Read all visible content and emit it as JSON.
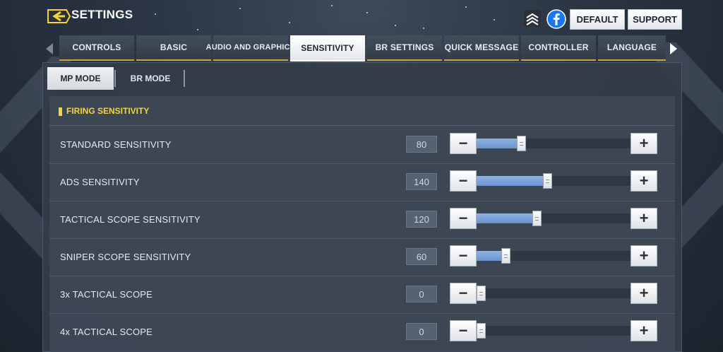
{
  "header": {
    "title": "SETTINGS",
    "default_label": "DEFAULT",
    "support_label": "SUPPORT",
    "back_icon": "back-arrow-icon",
    "cod_icon": "cod-chevron-icon",
    "facebook_icon": "facebook-icon"
  },
  "tabs": [
    {
      "label": "CONTROLS",
      "active": false
    },
    {
      "label": "BASIC",
      "active": false
    },
    {
      "label": "AUDIO AND GRAPHICS",
      "active": false
    },
    {
      "label": "SENSITIVITY",
      "active": true
    },
    {
      "label": "BR SETTINGS",
      "active": false
    },
    {
      "label": "QUICK MESSAGE",
      "active": false
    },
    {
      "label": "CONTROLLER",
      "active": false
    },
    {
      "label": "LANGUAGE",
      "active": false
    }
  ],
  "modes": [
    {
      "label": "MP MODE",
      "active": true
    },
    {
      "label": "BR MODE",
      "active": false
    }
  ],
  "section": {
    "title": "FIRING SENSITIVITY"
  },
  "rows": [
    {
      "label": "STANDARD SENSITIVITY",
      "value": "80",
      "level": 0.29
    },
    {
      "label": "ADS SENSITIVITY",
      "value": "140",
      "level": 0.46
    },
    {
      "label": "TACTICAL SCOPE SENSITIVITY",
      "value": "120",
      "level": 0.39
    },
    {
      "label": "SNIPER SCOPE SENSITIVITY",
      "value": "60",
      "level": 0.19
    },
    {
      "label": "3x TACTICAL SCOPE",
      "value": "0",
      "level": 0.0
    },
    {
      "label": "4x TACTICAL SCOPE",
      "value": "0",
      "level": 0.0
    }
  ],
  "colors": {
    "accent_yellow": "#f3d43a",
    "slider_fill": "#7aa0d8",
    "tab_underline": "#c9a53a",
    "facebook_blue": "#1877f2"
  }
}
